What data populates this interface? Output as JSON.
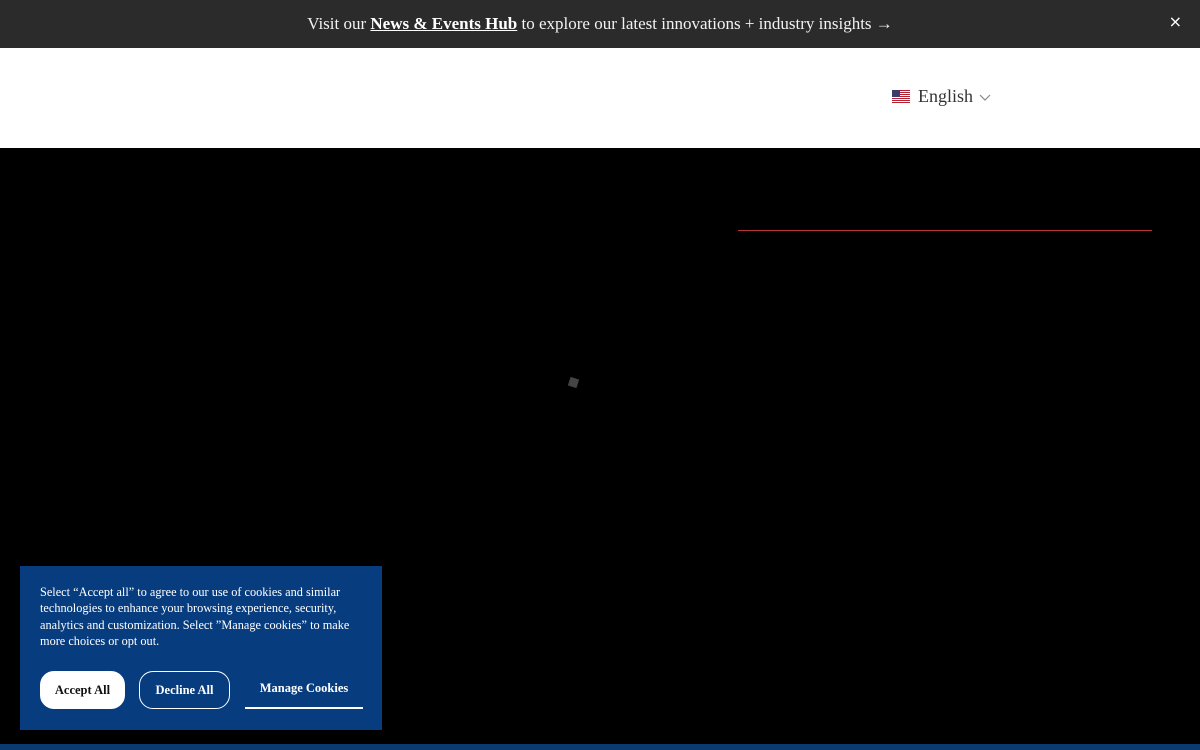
{
  "announcement": {
    "prefix": "Visit our ",
    "link_label": "News & Events Hub",
    "suffix": " to explore our latest innovations + industry insights →",
    "close_label": "×"
  },
  "header": {
    "language": {
      "label": "English",
      "flag_icon": "us-flag-icon",
      "dropdown_icon": "chevron-down-icon"
    }
  },
  "hero": {
    "accent_color": "#b8353b",
    "loading_icon": "loading-spinner-icon"
  },
  "cookie_banner": {
    "message": "Select “Accept all” to agree to our use of cookies and similar technologies to enhance your browsing experience, security, analytics and customization. Select ”Manage cookies” to make more choices or opt out.",
    "accept_label": "Accept All",
    "decline_label": "Decline All",
    "manage_label": "Manage Cookies",
    "background_color": "#073c7e"
  }
}
